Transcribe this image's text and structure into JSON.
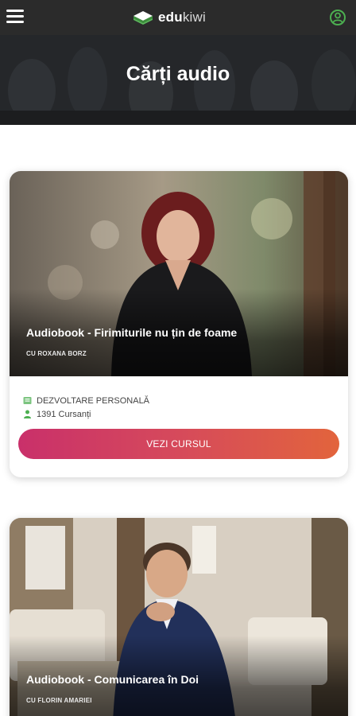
{
  "app": {
    "brand_bold": "edu",
    "brand_light": "kiwi"
  },
  "hero": {
    "title": "Cărți audio"
  },
  "courses": [
    {
      "title": "Audiobook - Firimiturile nu țin de foame",
      "author": "CU ROXANA BORZ",
      "category": "DEZVOLTARE PERSONALĂ",
      "students": "1391 Cursanți",
      "cta": "VEZI CURSUL"
    },
    {
      "title": "Audiobook - Comunicarea în Doi",
      "author": "CU FLORIN AMARIEI"
    }
  ],
  "colors": {
    "topbar": "#2b2b2b",
    "accent_green": "#4caf50",
    "cta_gradient_start": "#c9306a",
    "cta_gradient_end": "#e2643c"
  },
  "icons": {
    "menu": "hamburger-menu-icon",
    "account": "user-circle-icon",
    "category": "book-icon",
    "students": "person-icon"
  }
}
